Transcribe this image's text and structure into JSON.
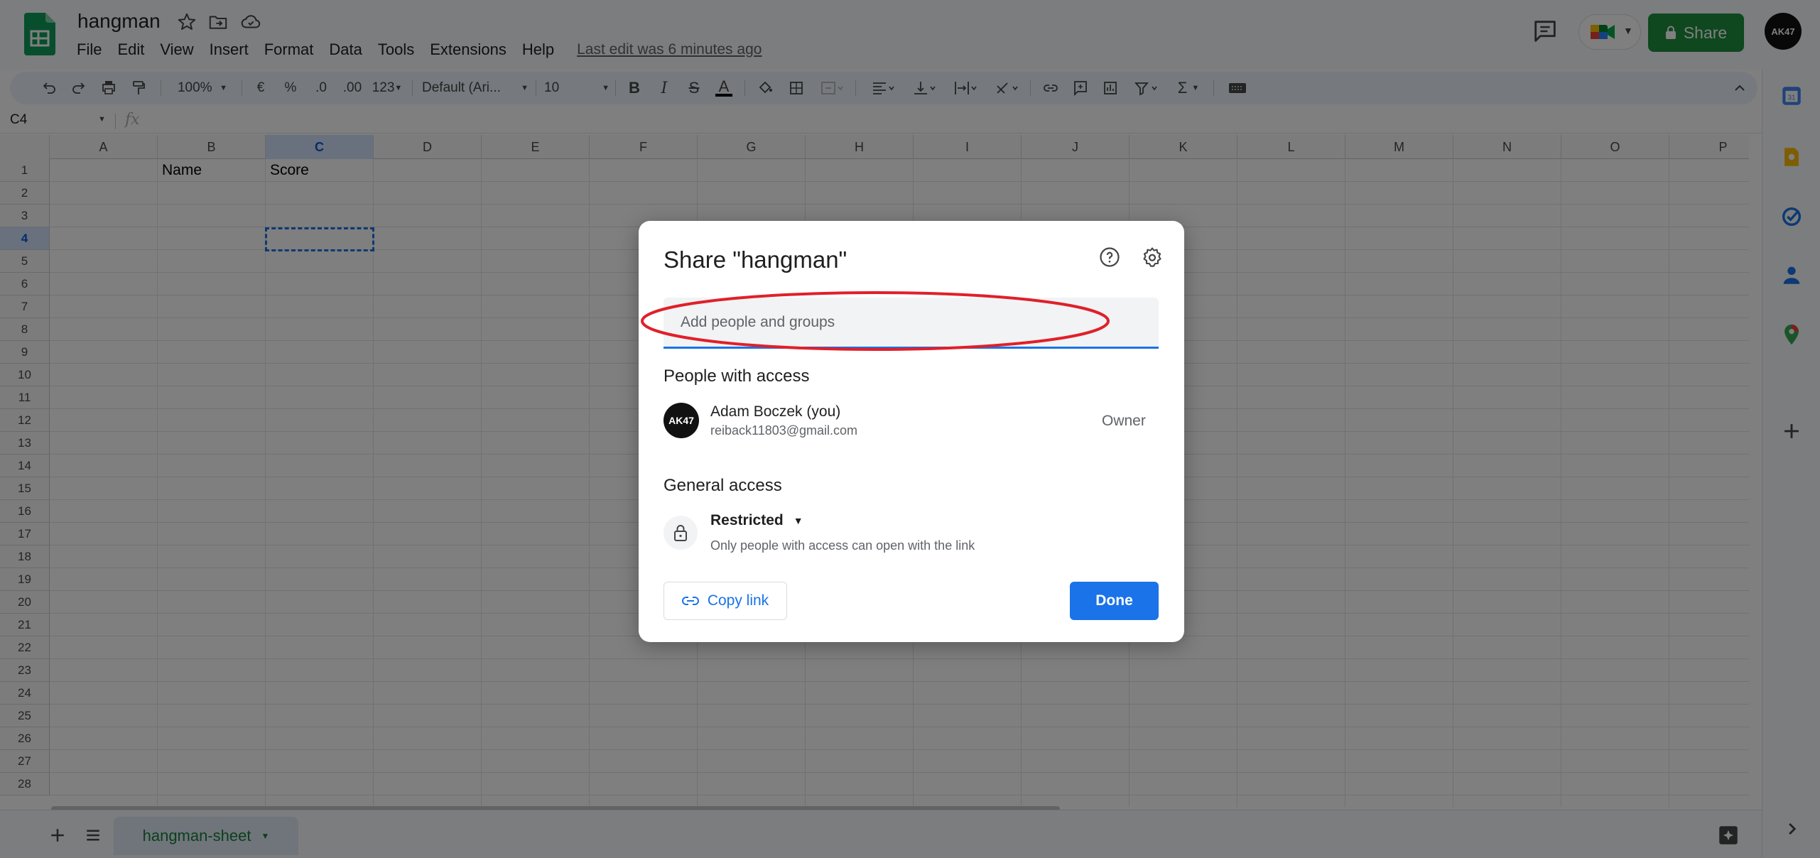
{
  "header": {
    "doc_title": "hangman",
    "menu": [
      "File",
      "Edit",
      "View",
      "Insert",
      "Format",
      "Data",
      "Tools",
      "Extensions",
      "Help"
    ],
    "last_edit": "Last edit was 6 minutes ago",
    "share_label": "Share",
    "avatar_text": "AK47"
  },
  "toolbar": {
    "zoom": "100%",
    "currency": "€",
    "percent": "%",
    "decrease_decimal": ".0",
    "increase_decimal": ".00",
    "more_formats": "123",
    "font": "Default (Ari...",
    "font_size": "10",
    "bold": "B",
    "italic": "I",
    "strikethrough": "S",
    "text_color": "A"
  },
  "formula_bar": {
    "name_box": "C4",
    "fx": "fx"
  },
  "grid": {
    "columns": [
      "A",
      "B",
      "C",
      "D",
      "E",
      "F",
      "G",
      "H",
      "I",
      "J",
      "K",
      "L",
      "M",
      "N",
      "O",
      "P"
    ],
    "rows": [
      "1",
      "2",
      "3",
      "4",
      "5",
      "6",
      "7",
      "8",
      "9",
      "10",
      "11",
      "12",
      "13",
      "14",
      "15",
      "16",
      "17",
      "18",
      "19",
      "20",
      "21",
      "22",
      "23",
      "24",
      "25",
      "26",
      "27",
      "28"
    ],
    "selected_cell": "C4",
    "cells": {
      "B1": "Name",
      "C1": "Score"
    }
  },
  "bottom": {
    "sheet_tab": "hangman-sheet"
  },
  "share_dialog": {
    "title": "Share \"hangman\"",
    "add_people_placeholder": "Add people and groups",
    "people_section": "People with access",
    "person": {
      "name": "Adam Boczek (you)",
      "email": "reiback11803@gmail.com",
      "role": "Owner",
      "avatar_text": "AK47"
    },
    "general_section": "General access",
    "access_level": "Restricted",
    "access_description": "Only people with access can open with the link",
    "copy_link_label": "Copy link",
    "done_label": "Done"
  },
  "colors": {
    "sheets_green": "#188038",
    "share_button": "#1e8e3e",
    "primary_blue": "#1a73e8",
    "annotation_red": "#e0202a"
  },
  "icons": [
    "star-icon",
    "move-folder-icon",
    "cloud-saved-icon",
    "comments-icon",
    "meet-icon",
    "lock-icon",
    "help-icon",
    "settings-icon",
    "link-icon",
    "add-sheet-icon",
    "all-sheets-icon",
    "explore-icon"
  ]
}
